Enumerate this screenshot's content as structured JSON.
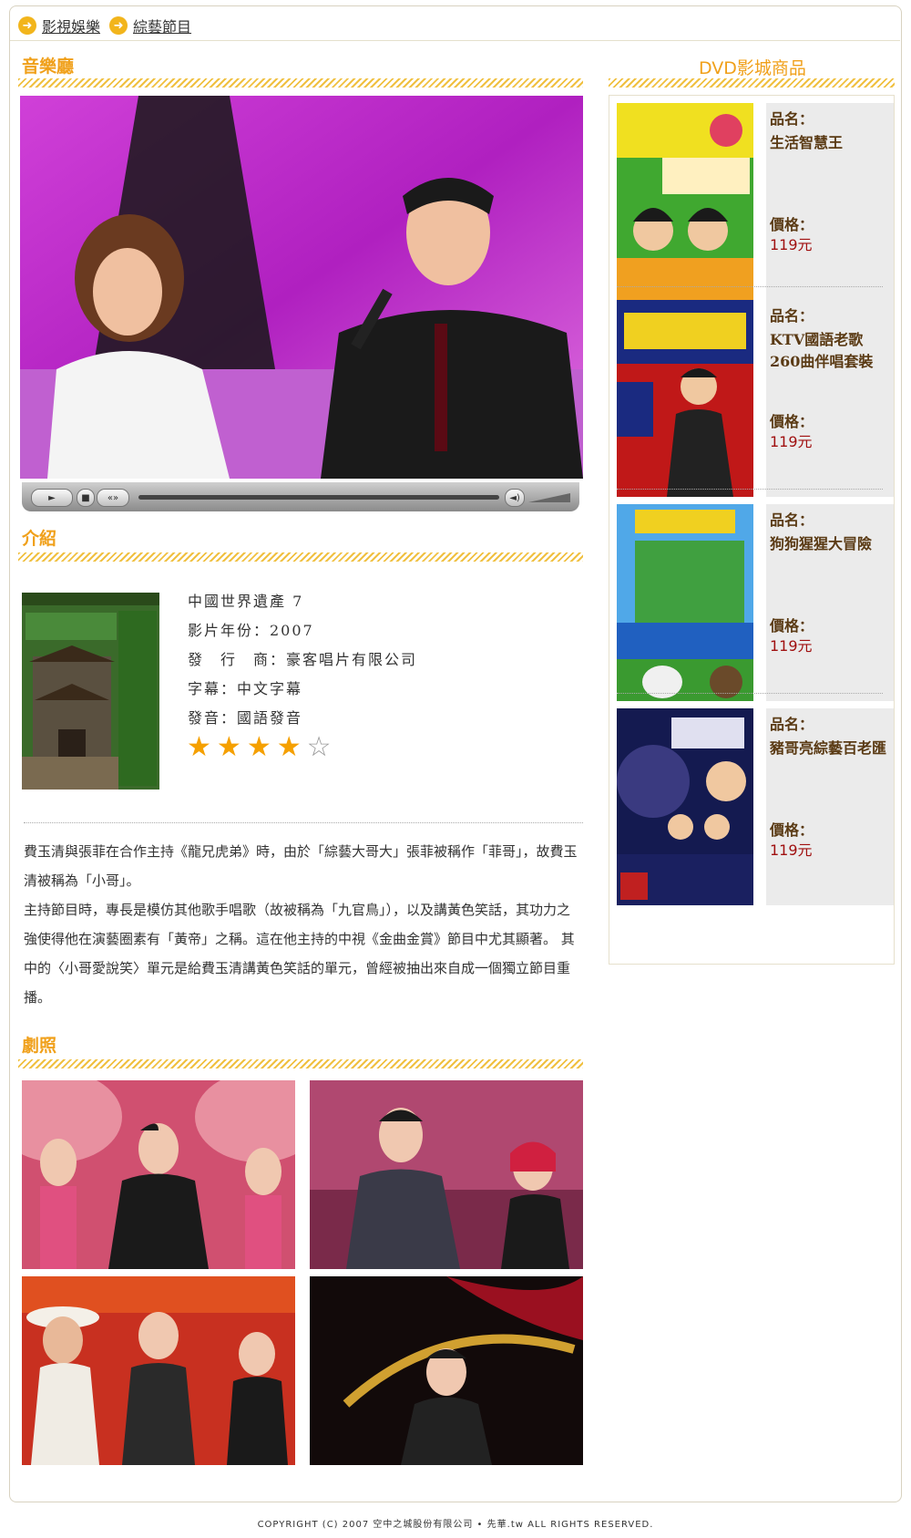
{
  "breadcrumbs": [
    {
      "label": "影視娛樂"
    },
    {
      "label": "綜藝節目"
    }
  ],
  "sections": {
    "music_hall": "音樂廳",
    "intro": "介紹",
    "stills": "劇照",
    "sidebar": "DVD影城商品"
  },
  "product": {
    "title": "中國世界遺產 7",
    "year": "影片年份：2007",
    "publisher": "發　行　商：豪客唱片有限公司",
    "subtitle": "字幕：中文字幕",
    "audio": "發音：國語發音",
    "rating": 4,
    "rating_max": 5
  },
  "description": [
    "費玉清與張菲在合作主持《龍兄虎弟》時，由於「綜藝大哥大」張菲被稱作「菲哥」，故費玉清被稱為「小哥」。",
    "主持節目時，專長是模仿其他歌手唱歌（故被稱為「九官鳥」），以及講黃色笑話，其功力之強使得他在演藝圈素有「黃帝」之稱。這在他主持的中視《金曲金賞》節目中尤其顯著。 其中的〈小哥愛說笑〉單元是給費玉清講黃色笑話的單元，曾經被抽出來自成一個獨立節目重播。"
  ],
  "sidebar": {
    "name_label": "品名：",
    "price_label": "價格：",
    "items": [
      {
        "name": "生活智慧王",
        "price": "119元"
      },
      {
        "name": "KTV國語老歌260曲伴唱套裝",
        "price": "119元"
      },
      {
        "name": "狗狗猩猩大冒險",
        "price": "119元"
      },
      {
        "name": "豬哥亮綜藝百老匯",
        "price": "119元"
      }
    ]
  },
  "footer": {
    "copyright": "COPYRIGHT (C) 2007 空中之城股份有限公司 • 先華.tw  ALL RIGHTS RESERVED."
  },
  "colors": {
    "accent": "#f0a01a",
    "stripe": "#f0c040",
    "price": "#a01010",
    "star": "#f5a000"
  }
}
